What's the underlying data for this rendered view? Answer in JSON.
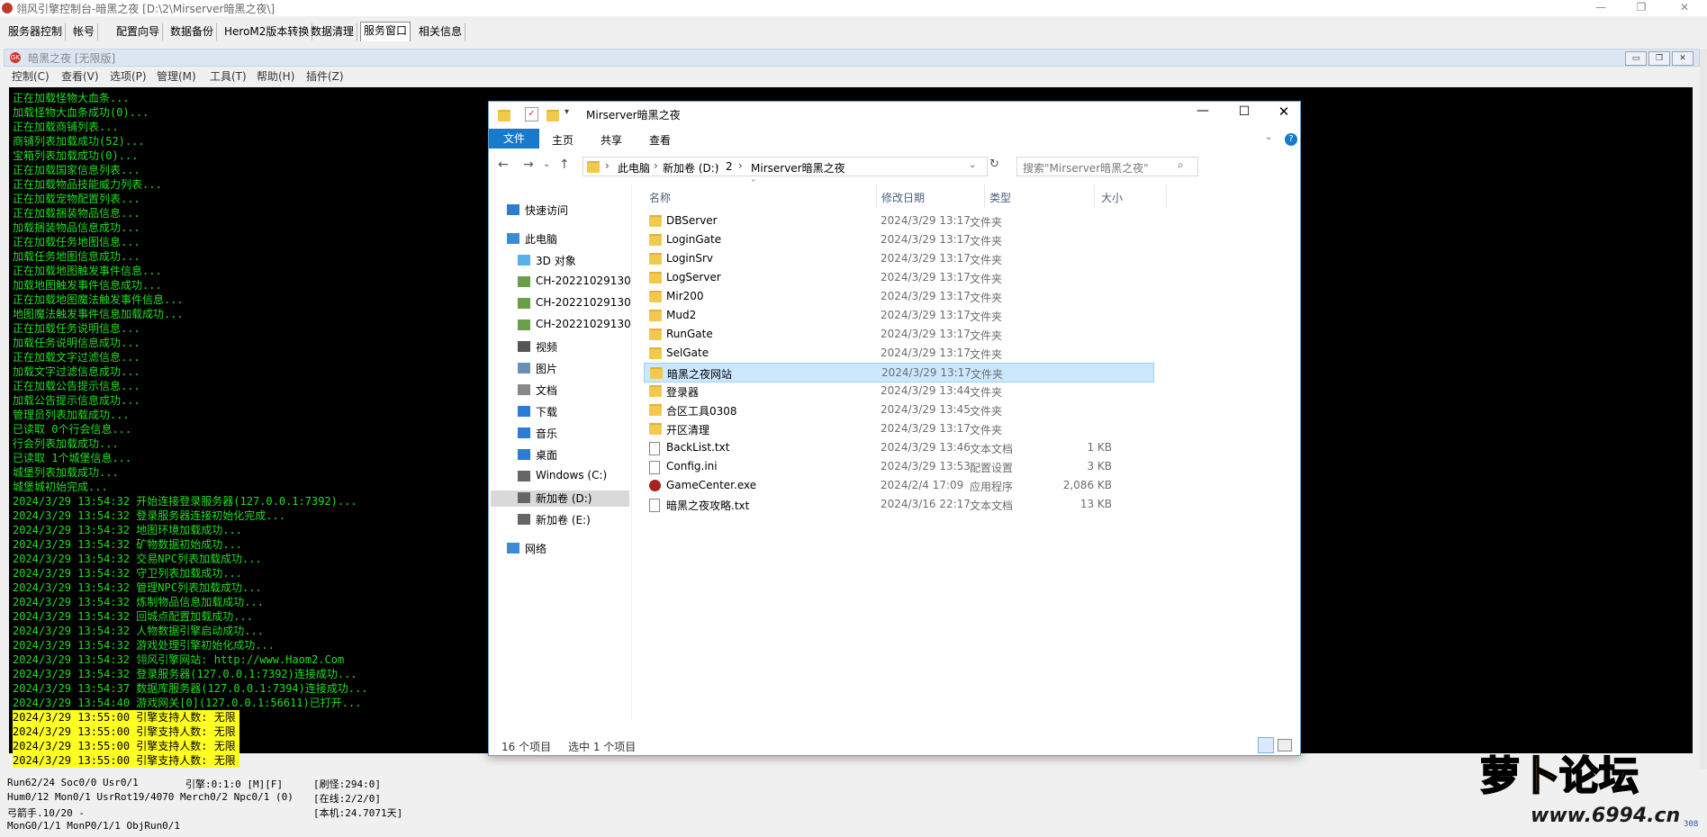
{
  "outer_title": "翎风引擎控制台-暗黑之夜 [D:\\2\\Mirserver暗黑之夜\\]",
  "outer_buttons": [
    "—",
    "❐",
    "✕"
  ],
  "main_tabs": [
    "服务器控制",
    "帐号",
    "配置向导",
    "数据备份",
    "HeroM2版本转换",
    "数据清理",
    "服务窗口",
    "相关信息"
  ],
  "child": {
    "title": "暗黑之夜 [无限版]",
    "icon_text": "GK",
    "buttons": [
      "▭",
      "❐",
      "✕"
    ],
    "menu": [
      "控制(C)",
      "查看(V)",
      "选项(P)",
      "管理(M)",
      "工具(T)",
      "帮助(H)",
      "插件(Z)"
    ]
  },
  "console_lines": [
    "正在加载怪物大血条...",
    "加载怪物大血条成功(0)...",
    "正在加载商铺列表...",
    "商铺列表加载成功(52)...",
    "宝箱列表加载成功(0)...",
    "正在加载国家信息列表...",
    "正在加载物品技能威力列表...",
    "正在加载宠物配置列表...",
    "正在加载捆装物品信息...",
    "加载捆装物品信息成功...",
    "正在加载任务地图信息...",
    "加载任务地图信息成功...",
    "正在加载地图触发事件信息...",
    "加载地图触发事件信息成功...",
    "正在加载地图魔法触发事件信息...",
    "地图魔法触发事件信息加载成功...",
    "正在加载任务说明信息...",
    "加载任务说明信息成功...",
    "正在加载文字过滤信息...",
    "加载文字过滤信息成功...",
    "正在加载公告提示信息...",
    "加载公告提示信息成功...",
    "管理员列表加载成功...",
    "已读取 0个行会信息...",
    "行会列表加载成功...",
    "已读取 1个城堡信息...",
    "城堡列表加载成功...",
    "城堡城初始完成...",
    "2024/3/29 13:54:32 开始连接登录服务器(127.0.0.1:7392)...",
    "2024/3/29 13:54:32 登录服务器连接初始化完成...",
    "2024/3/29 13:54:32 地图环境加载成功...",
    "2024/3/29 13:54:32 矿物数据初始成功...",
    "2024/3/29 13:54:32 交易NPC列表加载成功...",
    "2024/3/29 13:54:32 守卫列表加载成功...",
    "2024/3/29 13:54:32 管理NPC列表加载成功...",
    "2024/3/29 13:54:32 炼制物品信息加载成功...",
    "2024/3/29 13:54:32 回城点配置加载成功...",
    "2024/3/29 13:54:32 人物数据引擎启动成功...",
    "2024/3/29 13:54:32 游戏处理引擎初始化成功...",
    "2024/3/29 13:54:32 翎风引擎网站: http://www.Haom2.Com",
    "2024/3/29 13:54:32 登录服务器(127.0.0.1:7392)连接成功...",
    "2024/3/29 13:54:37 数据库服务器(127.0.0.1:7394)连接成功...",
    "2024/3/29 13:54:40 游戏网关[0](127.0.0.1:56611)已打开..."
  ],
  "console_highlight_lines": [
    "2024/3/29 13:55:00 引擎支持人数: 无限",
    "2024/3/29 13:55:00 引擎支持人数: 无限",
    "2024/3/29 13:55:00 引擎支持人数: 无限",
    "2024/3/29 13:55:00 引擎支持人数: 无限"
  ],
  "status": {
    "l1": "Run62/24 Soc0/0 Usr0/1",
    "l2": "Hum0/12 Mon0/1 UsrRot19/4070 Merch0/2 Npc0/1 (0)",
    "l3": "弓箭手.10/20 -",
    "l4": "MonG0/1/1 MonP0/1/1 ObjRun0/1",
    "engine": "引擎:0:1:0 [M][F]",
    "refresh": "[刷怪:294:0]",
    "online": "[在线:2/2/0]",
    "local": "[本机:24.7071天]",
    "corner": "308"
  },
  "explorer": {
    "title": "Mirserver暗黑之夜",
    "ribbon_tabs": [
      "文件",
      "主页",
      "共享",
      "查看"
    ],
    "path": [
      "此电脑",
      "新加卷 (D:)",
      "2",
      "Mirserver暗黑之夜"
    ],
    "search_placeholder": "搜索\"Mirserver暗黑之夜\"",
    "columns": [
      "名称",
      "修改日期",
      "类型",
      "大小"
    ],
    "nav": [
      {
        "label": "快速访问",
        "icon": "star-icon"
      },
      {
        "label": "此电脑",
        "icon": "computer-icon"
      },
      {
        "label": "3D 对象",
        "icon": "cube-icon"
      },
      {
        "label": "CH-20221029130",
        "icon": "network-drive-icon"
      },
      {
        "label": "CH-20221029130",
        "icon": "network-drive-icon"
      },
      {
        "label": "CH-20221029130",
        "icon": "network-drive-icon"
      },
      {
        "label": "视频",
        "icon": "video-icon"
      },
      {
        "label": "图片",
        "icon": "picture-icon"
      },
      {
        "label": "文档",
        "icon": "document-icon"
      },
      {
        "label": "下载",
        "icon": "download-icon"
      },
      {
        "label": "音乐",
        "icon": "music-icon"
      },
      {
        "label": "桌面",
        "icon": "desktop-icon"
      },
      {
        "label": "Windows (C:)",
        "icon": "drive-icon"
      },
      {
        "label": "新加卷 (D:)",
        "icon": "drive-icon"
      },
      {
        "label": "新加卷 (E:)",
        "icon": "drive-icon"
      },
      {
        "label": "网络",
        "icon": "network-icon"
      }
    ],
    "files": [
      {
        "name": "DBServer",
        "date": "2024/3/29 13:17",
        "type": "文件夹",
        "size": "",
        "icon": "folder-icon"
      },
      {
        "name": "LoginGate",
        "date": "2024/3/29 13:17",
        "type": "文件夹",
        "size": "",
        "icon": "folder-icon"
      },
      {
        "name": "LoginSrv",
        "date": "2024/3/29 13:17",
        "type": "文件夹",
        "size": "",
        "icon": "folder-icon"
      },
      {
        "name": "LogServer",
        "date": "2024/3/29 13:17",
        "type": "文件夹",
        "size": "",
        "icon": "folder-icon"
      },
      {
        "name": "Mir200",
        "date": "2024/3/29 13:17",
        "type": "文件夹",
        "size": "",
        "icon": "folder-icon"
      },
      {
        "name": "Mud2",
        "date": "2024/3/29 13:17",
        "type": "文件夹",
        "size": "",
        "icon": "folder-icon"
      },
      {
        "name": "RunGate",
        "date": "2024/3/29 13:17",
        "type": "文件夹",
        "size": "",
        "icon": "folder-icon"
      },
      {
        "name": "SelGate",
        "date": "2024/3/29 13:17",
        "type": "文件夹",
        "size": "",
        "icon": "folder-icon"
      },
      {
        "name": "暗黑之夜网站",
        "date": "2024/3/29 13:17",
        "type": "文件夹",
        "size": "",
        "icon": "folder-icon"
      },
      {
        "name": "登录器",
        "date": "2024/3/29 13:44",
        "type": "文件夹",
        "size": "",
        "icon": "folder-icon"
      },
      {
        "name": "合区工具0308",
        "date": "2024/3/29 13:45",
        "type": "文件夹",
        "size": "",
        "icon": "folder-icon"
      },
      {
        "name": "开区清理",
        "date": "2024/3/29 13:17",
        "type": "文件夹",
        "size": "",
        "icon": "folder-icon"
      },
      {
        "name": "BackList.txt",
        "date": "2024/3/29 13:46",
        "type": "文本文档",
        "size": "1 KB",
        "icon": "text-file-icon"
      },
      {
        "name": "Config.ini",
        "date": "2024/3/29 13:53",
        "type": "配置设置",
        "size": "3 KB",
        "icon": "ini-file-icon"
      },
      {
        "name": "GameCenter.exe",
        "date": "2024/2/4 17:09",
        "type": "应用程序",
        "size": "2,086 KB",
        "icon": "exe-icon"
      },
      {
        "name": "暗黑之夜攻略.txt",
        "date": "2024/3/16 22:17",
        "type": "文本文档",
        "size": "13 KB",
        "icon": "text-file-icon"
      }
    ],
    "item_count": "16 个项目",
    "selected_count": "选中 1 个项目"
  },
  "watermark": {
    "logo": "萝卜论坛",
    "url": "www.6994.cn"
  }
}
